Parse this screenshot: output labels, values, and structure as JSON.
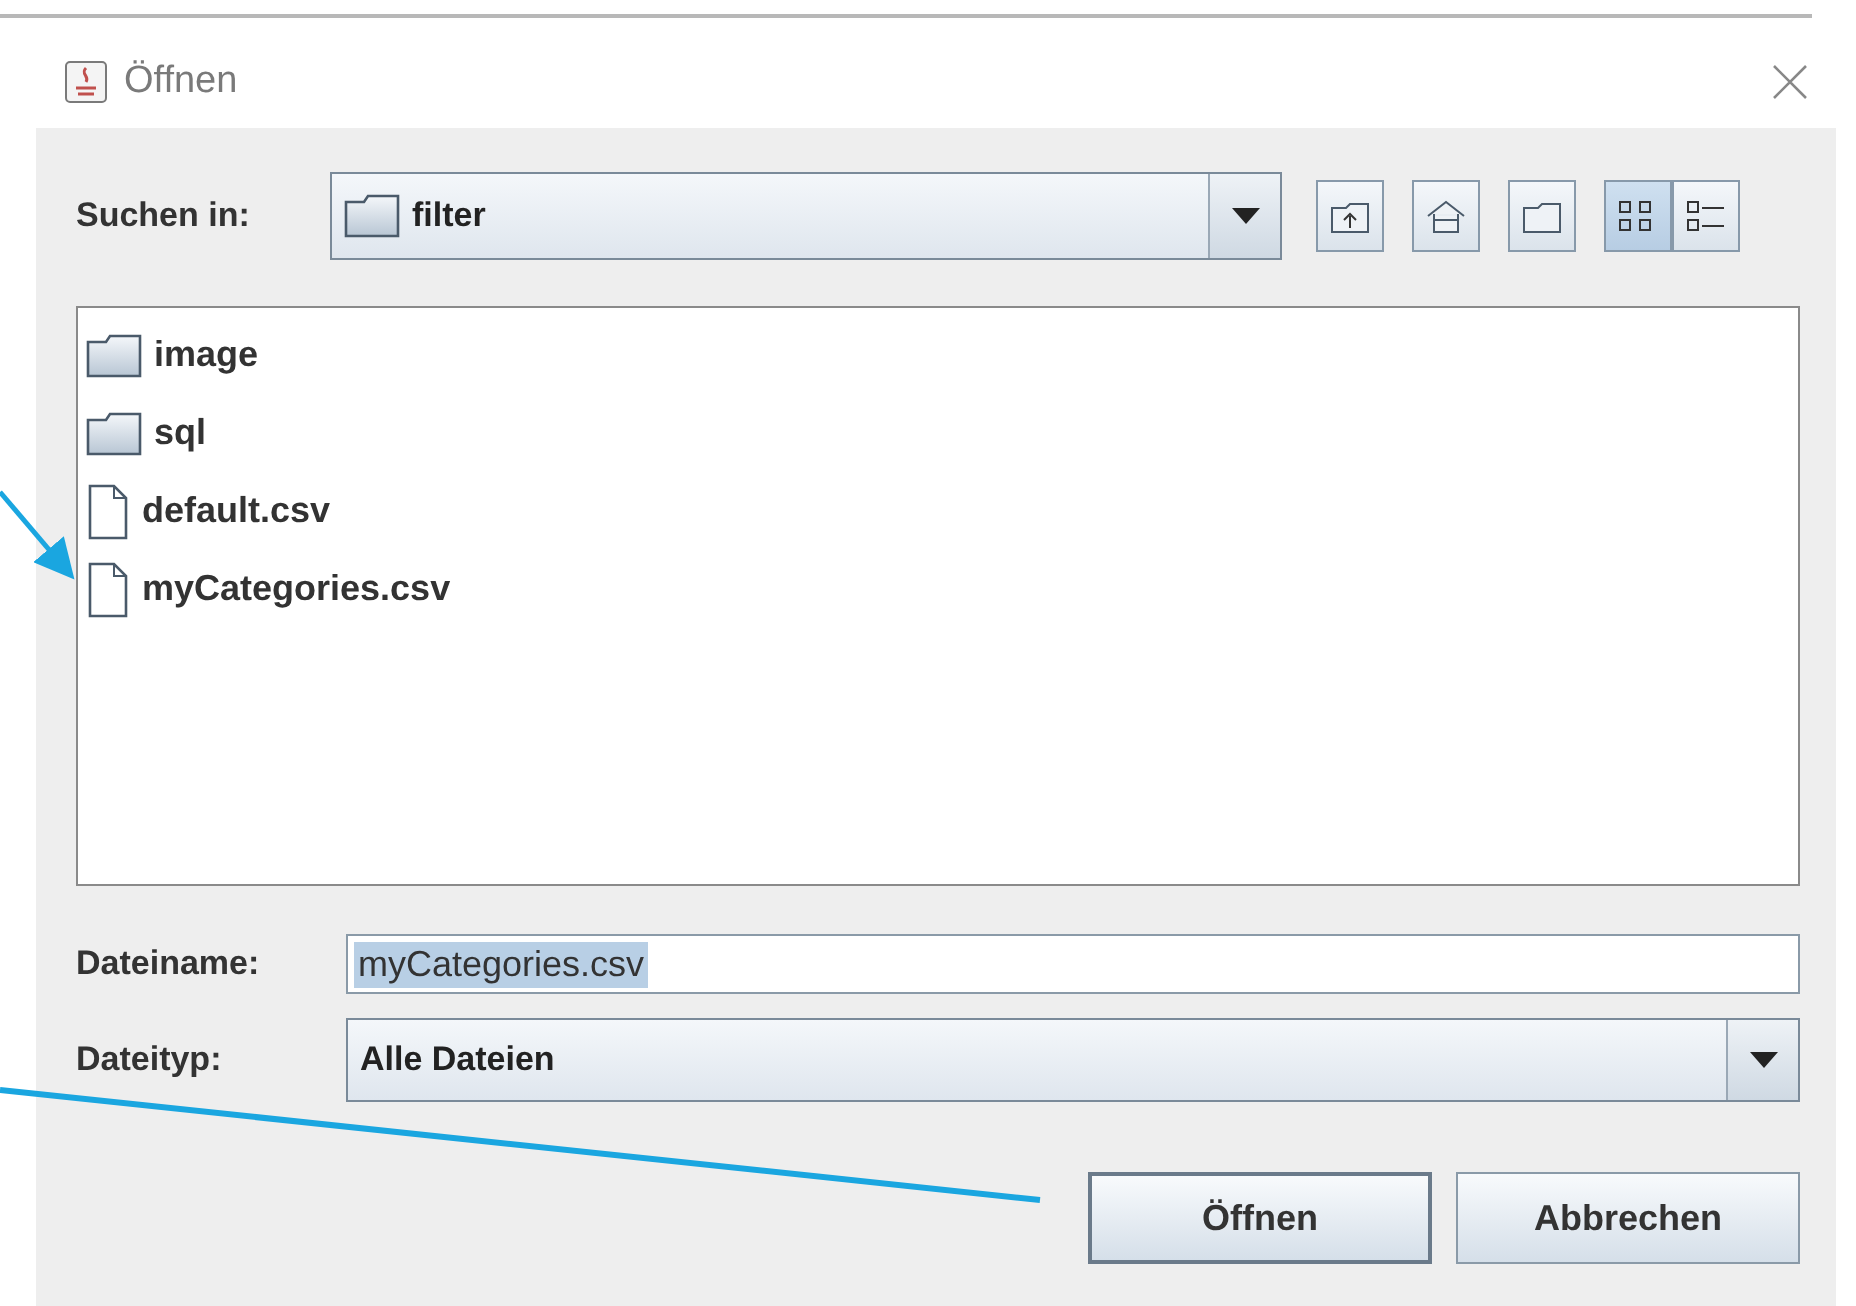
{
  "window": {
    "title": "Öffnen"
  },
  "look_in": {
    "label": "Suchen in:",
    "value": "filter"
  },
  "toolbar": [
    {
      "kind": "up",
      "selected": false
    },
    {
      "kind": "home",
      "selected": false
    },
    {
      "kind": "new-folder",
      "selected": false
    },
    {
      "kind": "list",
      "selected": true
    },
    {
      "kind": "details",
      "selected": false
    }
  ],
  "files": [
    {
      "kind": "folder",
      "name": "image"
    },
    {
      "kind": "folder",
      "name": "sql"
    },
    {
      "kind": "file",
      "name": "default.csv"
    },
    {
      "kind": "file",
      "name": "myCategories.csv"
    }
  ],
  "file_name": {
    "label": "Dateiname:",
    "value": "myCategories.csv",
    "highlighted": true
  },
  "file_type": {
    "label": "Dateityp:",
    "value": "Alle Dateien"
  },
  "buttons": [
    {
      "label": "Öffnen",
      "focused": true
    },
    {
      "label": "Abbrechen",
      "focused": false
    }
  ]
}
